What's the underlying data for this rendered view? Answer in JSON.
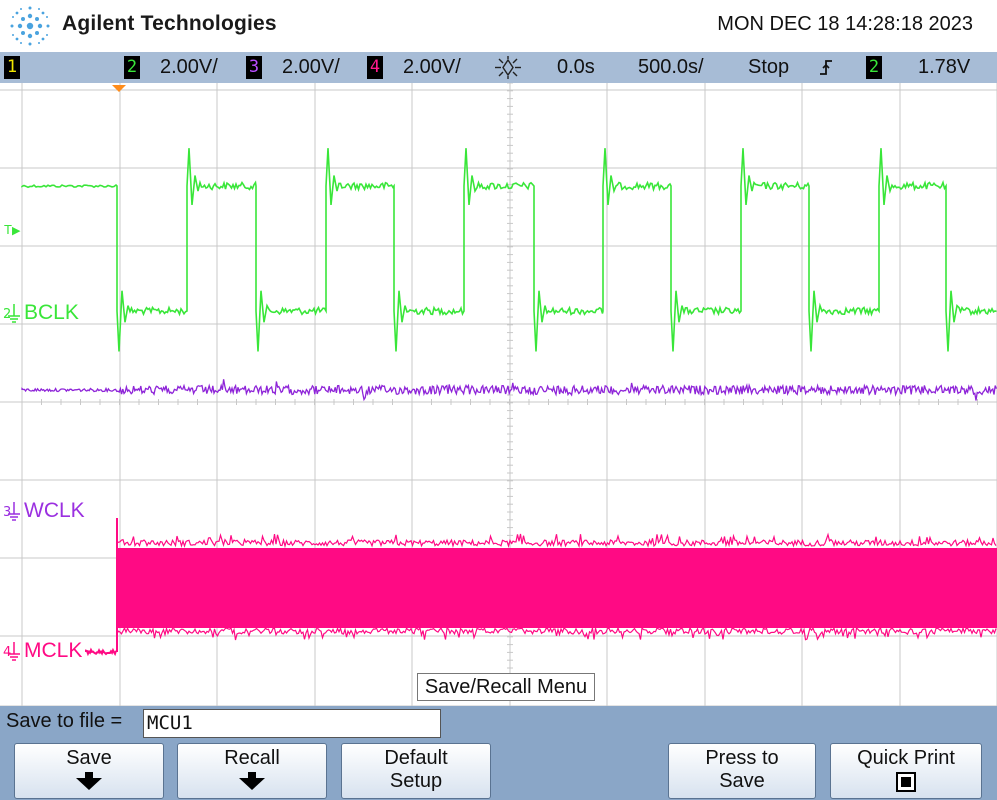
{
  "header": {
    "brand": "Agilent Technologies",
    "datetime": "MON DEC 18 14:28:18 2023"
  },
  "statusbar": {
    "ch1": {
      "num": "1",
      "color": "#f2e600"
    },
    "ch2": {
      "num": "2",
      "scale": "2.00V/",
      "color": "#39e639"
    },
    "ch3": {
      "num": "3",
      "scale": "2.00V/",
      "color": "#9b30e0"
    },
    "ch4": {
      "num": "4",
      "scale": "2.00V/",
      "color": "#ff1a8c"
    },
    "delay": "0.0s",
    "timebase": "500.0s/",
    "run_state": "Stop",
    "trigger_source": "2",
    "trigger_level": "1.78V"
  },
  "screen": {
    "labels": {
      "bclk": {
        "num": "2",
        "text": "BCLK",
        "color": "#39e639"
      },
      "wclk": {
        "num": "3",
        "text": "WCLK",
        "color": "#9b30e0"
      },
      "mclk": {
        "num": "4",
        "text": "MCLK",
        "color": "#ff0a84"
      }
    },
    "trigger_marker": "T",
    "menu_title": "Save/Recall Menu"
  },
  "softbar": {
    "save_to_file_label": "Save to file =",
    "filename": "MCU1",
    "keys": {
      "save": "Save",
      "recall": "Recall",
      "default_setup_1": "Default",
      "default_setup_2": "Setup",
      "press_to_save_1": "Press to",
      "press_to_save_2": "Save",
      "quick_print": "Quick Print"
    }
  },
  "colors": {
    "grid": "#c8c8c8",
    "trace_bclk": "#39e639",
    "trace_wclk": "#8e24d8",
    "trace_mclk": "#ff0a84",
    "statusbar_bg": "#a7bcd6",
    "softbar_bg": "#8aa6c7"
  }
}
